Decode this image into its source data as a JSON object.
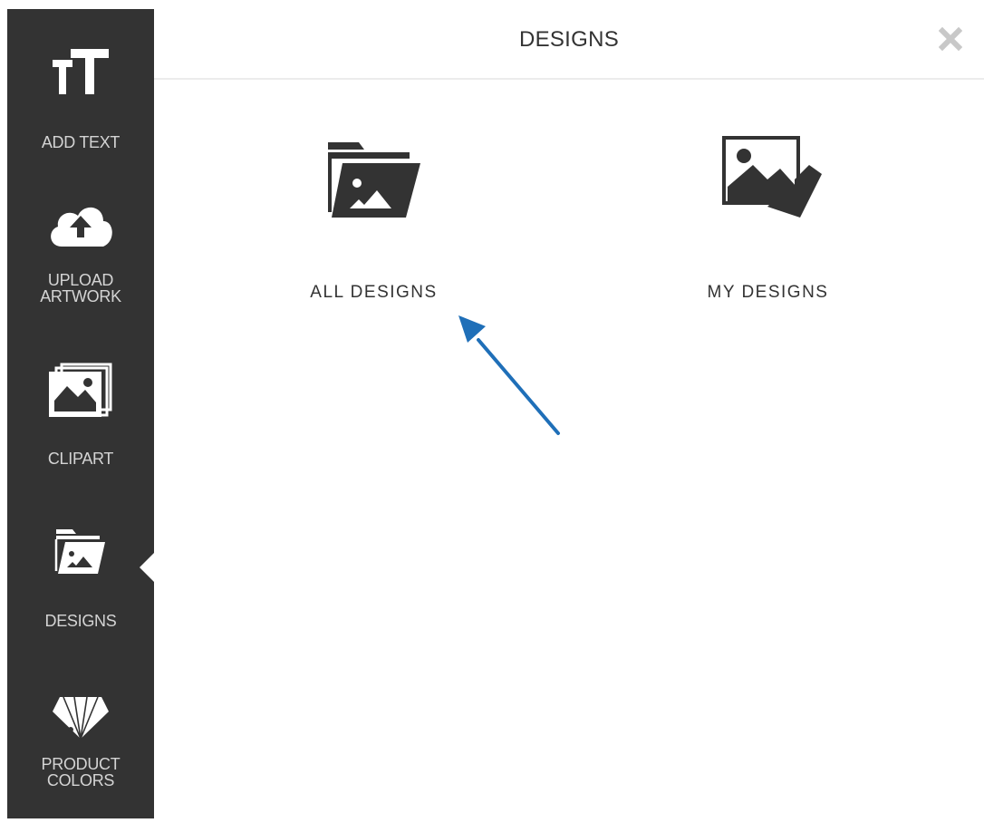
{
  "sidebar": {
    "items": [
      {
        "id": "add-text",
        "label_lines": [
          "ADD TEXT"
        ],
        "icon": "text-size-icon"
      },
      {
        "id": "upload-artwork",
        "label_lines": [
          "UPLOAD",
          "ARTWORK"
        ],
        "icon": "cloud-upload-icon"
      },
      {
        "id": "clipart",
        "label_lines": [
          "CLIPART"
        ],
        "icon": "image-stack-icon"
      },
      {
        "id": "designs",
        "label_lines": [
          "DESIGNS"
        ],
        "icon": "image-folder-icon",
        "active": true
      },
      {
        "id": "product-colors",
        "label_lines": [
          "PRODUCT",
          "COLORS"
        ],
        "icon": "color-swatch-icon"
      }
    ]
  },
  "panel": {
    "title": "DESIGNS",
    "close_icon": "close-icon",
    "tiles": [
      {
        "id": "all-designs",
        "label": "ALL DESIGNS",
        "icon": "image-folder-icon"
      },
      {
        "id": "my-designs",
        "label": "MY DESIGNS",
        "icon": "image-stack-icon"
      }
    ]
  },
  "annotation": {
    "icon": "arrow-pointer-icon",
    "color": "#1f6fb8"
  },
  "colors": {
    "sidebar_bg": "#333333",
    "sidebar_text": "#d4d4d4",
    "icon_dark": "#333333",
    "close": "#c8c8c8",
    "arrow": "#1f6fb8"
  }
}
